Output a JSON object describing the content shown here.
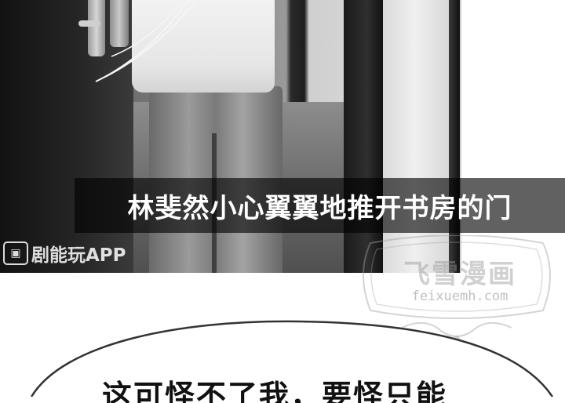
{
  "caption": {
    "text": "林斐然小心翼翼地推开书房的门"
  },
  "app_watermark": {
    "label": "剧能玩APP"
  },
  "site_watermark": {
    "title": "飞雪漫画",
    "url": "feixuemh.com"
  },
  "speech_bubble": {
    "text": "这可怪不了我，要怪只能"
  },
  "colors": {
    "caption_bg": "#000000",
    "caption_text": "#ffffff",
    "bubble_stroke": "#333333"
  }
}
